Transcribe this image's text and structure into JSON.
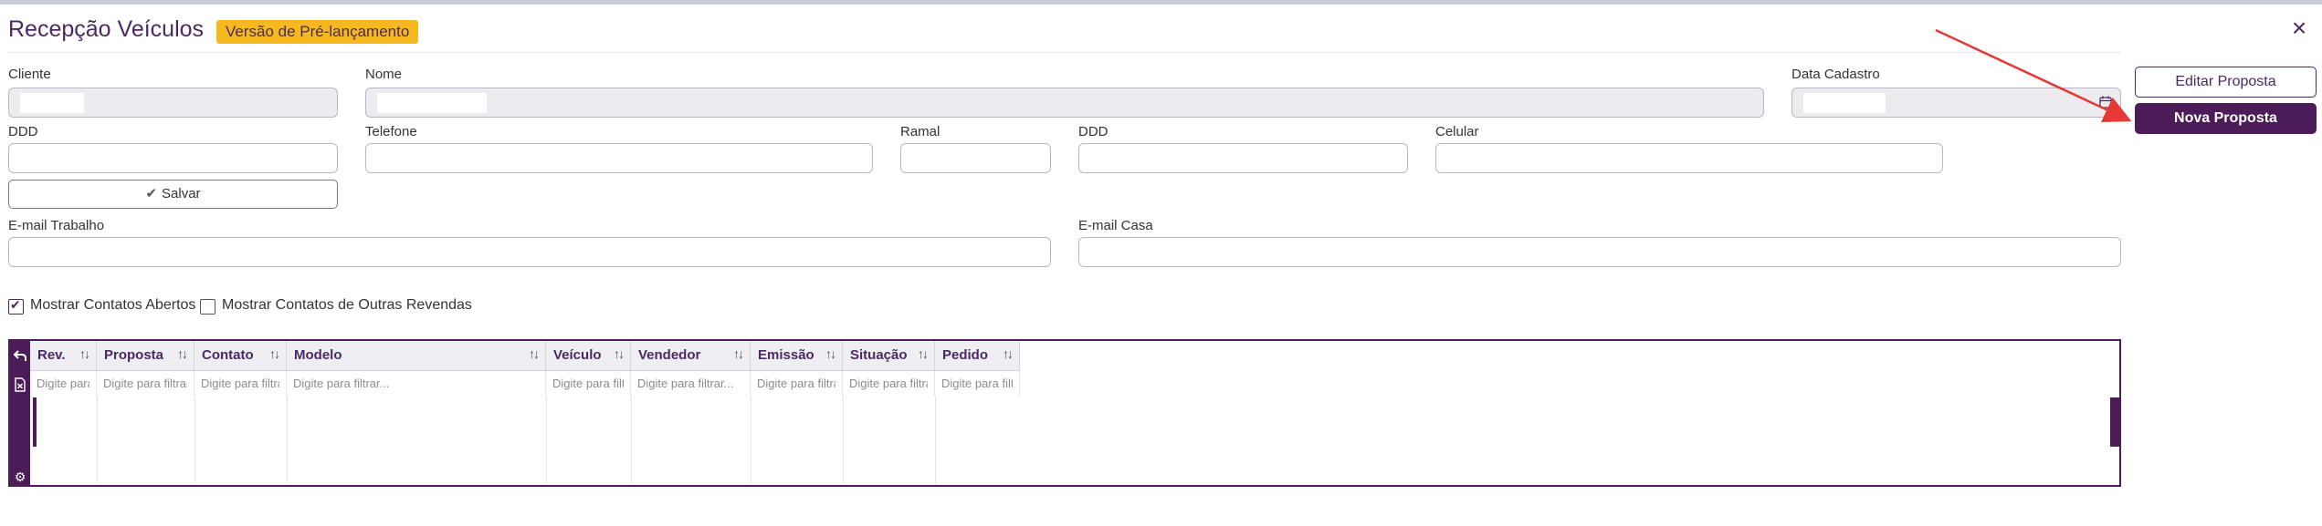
{
  "header": {
    "title": "Recepção Veículos",
    "badge": "Versão de Pré-lançamento",
    "close_icon": "×"
  },
  "form": {
    "cliente_label": "Cliente",
    "nome_label": "Nome",
    "data_cadastro_label": "Data Cadastro",
    "ddd1_label": "DDD",
    "telefone_label": "Telefone",
    "ramal_label": "Ramal",
    "ddd2_label": "DDD",
    "celular_label": "Celular",
    "email_trabalho_label": "E-mail Trabalho",
    "email_casa_label": "E-mail Casa",
    "salvar_label": "Salvar"
  },
  "actions": {
    "editar_label": "Editar Proposta",
    "nova_label": "Nova Proposta"
  },
  "options": {
    "mostrar_abertos_label": "Mostrar Contatos Abertos",
    "mostrar_abertos_checked": true,
    "mostrar_outras_label": "Mostrar Contatos de Outras Revendas",
    "mostrar_outras_checked": false
  },
  "grid": {
    "columns": [
      {
        "label": "Rev.",
        "placeholder": "Digite para filtrar..."
      },
      {
        "label": "Proposta",
        "placeholder": "Digite para filtrar..."
      },
      {
        "label": "Contato",
        "placeholder": "Digite para filtrar..."
      },
      {
        "label": "Modelo",
        "placeholder": "Digite para filtrar..."
      },
      {
        "label": "Veículo",
        "placeholder": "Digite para filtrar..."
      },
      {
        "label": "Vendedor",
        "placeholder": "Digite para filtrar..."
      },
      {
        "label": "Emissão",
        "placeholder": "Digite para filtrar..."
      },
      {
        "label": "Situação",
        "placeholder": "Digite para filtrar..."
      },
      {
        "label": "Pedido",
        "placeholder": "Digite para filtrar..."
      }
    ],
    "sort_icon": "↑↓",
    "side_icons": [
      "undo-icon",
      "excel-export-icon",
      "gear-icon"
    ]
  },
  "colors": {
    "brand": "#4b1c57",
    "accent": "#f5b91e",
    "annotation_arrow": "#e53935"
  }
}
